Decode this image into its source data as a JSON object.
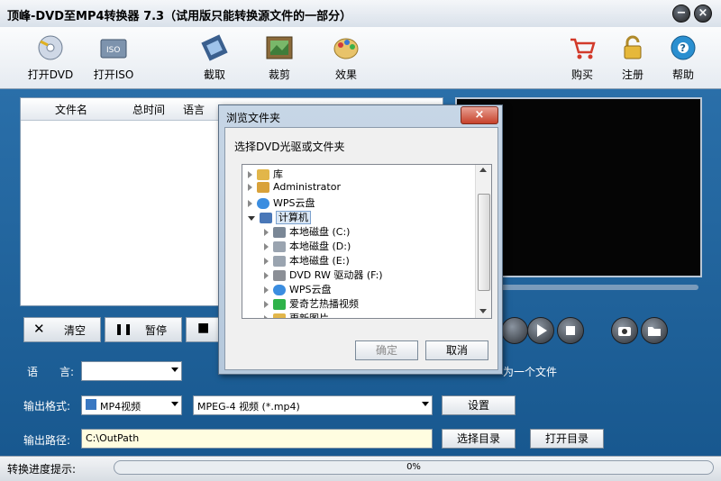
{
  "window": {
    "title": "顶峰-DVD至MP4转换器 7.3（试用版只能转换源文件的一部分）",
    "min_icon": "minimize-icon",
    "close_icon": "close-icon",
    "min_glyph": "−",
    "close_glyph": "×"
  },
  "toolbar": {
    "open_dvd": "打开DVD",
    "open_iso": "打开ISO",
    "capture": "截取",
    "crop": "裁剪",
    "effect": "效果",
    "buy": "购买",
    "register": "注册",
    "help": "帮助"
  },
  "list": {
    "headers": [
      "文件名",
      "总时间",
      "语言"
    ]
  },
  "controls": {
    "clear": "清空",
    "pause": "暂停",
    "clear_glyph": "✕",
    "pause_glyph": "❚❚",
    "stop_glyph": "■"
  },
  "form": {
    "language_label": "语　　言:",
    "language_value": "",
    "merge_text": "为一个文件",
    "output_format_label": "输出格式:",
    "format_value": "MP4视频",
    "profile_value": "MPEG-4 视频 (*.mp4)",
    "settings_button": "设置",
    "output_path_label": "输出路径:",
    "output_path_value": "C:\\OutPath",
    "choose_dir_button": "选择目录",
    "open_dir_button": "打开目录"
  },
  "status": {
    "label": "转换进度提示:",
    "progress_text": "0%",
    "progress": 0
  },
  "dialog": {
    "title": "浏览文件夹",
    "close_glyph": "×",
    "prompt": "选择DVD光驱或文件夹",
    "tree": [
      {
        "label": "库",
        "level": 0,
        "expanded": false,
        "icon": "library-icon"
      },
      {
        "label": "Administrator",
        "level": 0,
        "expanded": false,
        "icon": "user-folder-icon"
      },
      {
        "label": "WPS云盘",
        "level": 0,
        "expanded": false,
        "icon": "cloud-icon"
      },
      {
        "label": "计算机",
        "level": 0,
        "expanded": true,
        "icon": "computer-icon"
      },
      {
        "label": "本地磁盘 (C:)",
        "level": 1,
        "expanded": false,
        "icon": "system-drive-icon"
      },
      {
        "label": "本地磁盘 (D:)",
        "level": 1,
        "expanded": false,
        "icon": "drive-icon"
      },
      {
        "label": "本地磁盘 (E:)",
        "level": 1,
        "expanded": false,
        "icon": "drive-icon"
      },
      {
        "label": "DVD RW 驱动器 (F:)",
        "level": 1,
        "expanded": false,
        "icon": "dvd-drive-icon"
      },
      {
        "label": "WPS云盘",
        "level": 1,
        "expanded": false,
        "icon": "cloud-icon"
      },
      {
        "label": "爱奇艺热播视频",
        "level": 1,
        "expanded": false,
        "icon": "iqiyi-icon"
      },
      {
        "label": "更新图片",
        "level": 1,
        "expanded": false,
        "icon": "folder-icon"
      }
    ],
    "ok_button": "确定",
    "cancel_button": "取消"
  },
  "colors": {
    "main_background": "#1e5a8c",
    "video_preview": "#050505",
    "dialog_close": "#c6412b",
    "path_field": "#fffde0"
  }
}
